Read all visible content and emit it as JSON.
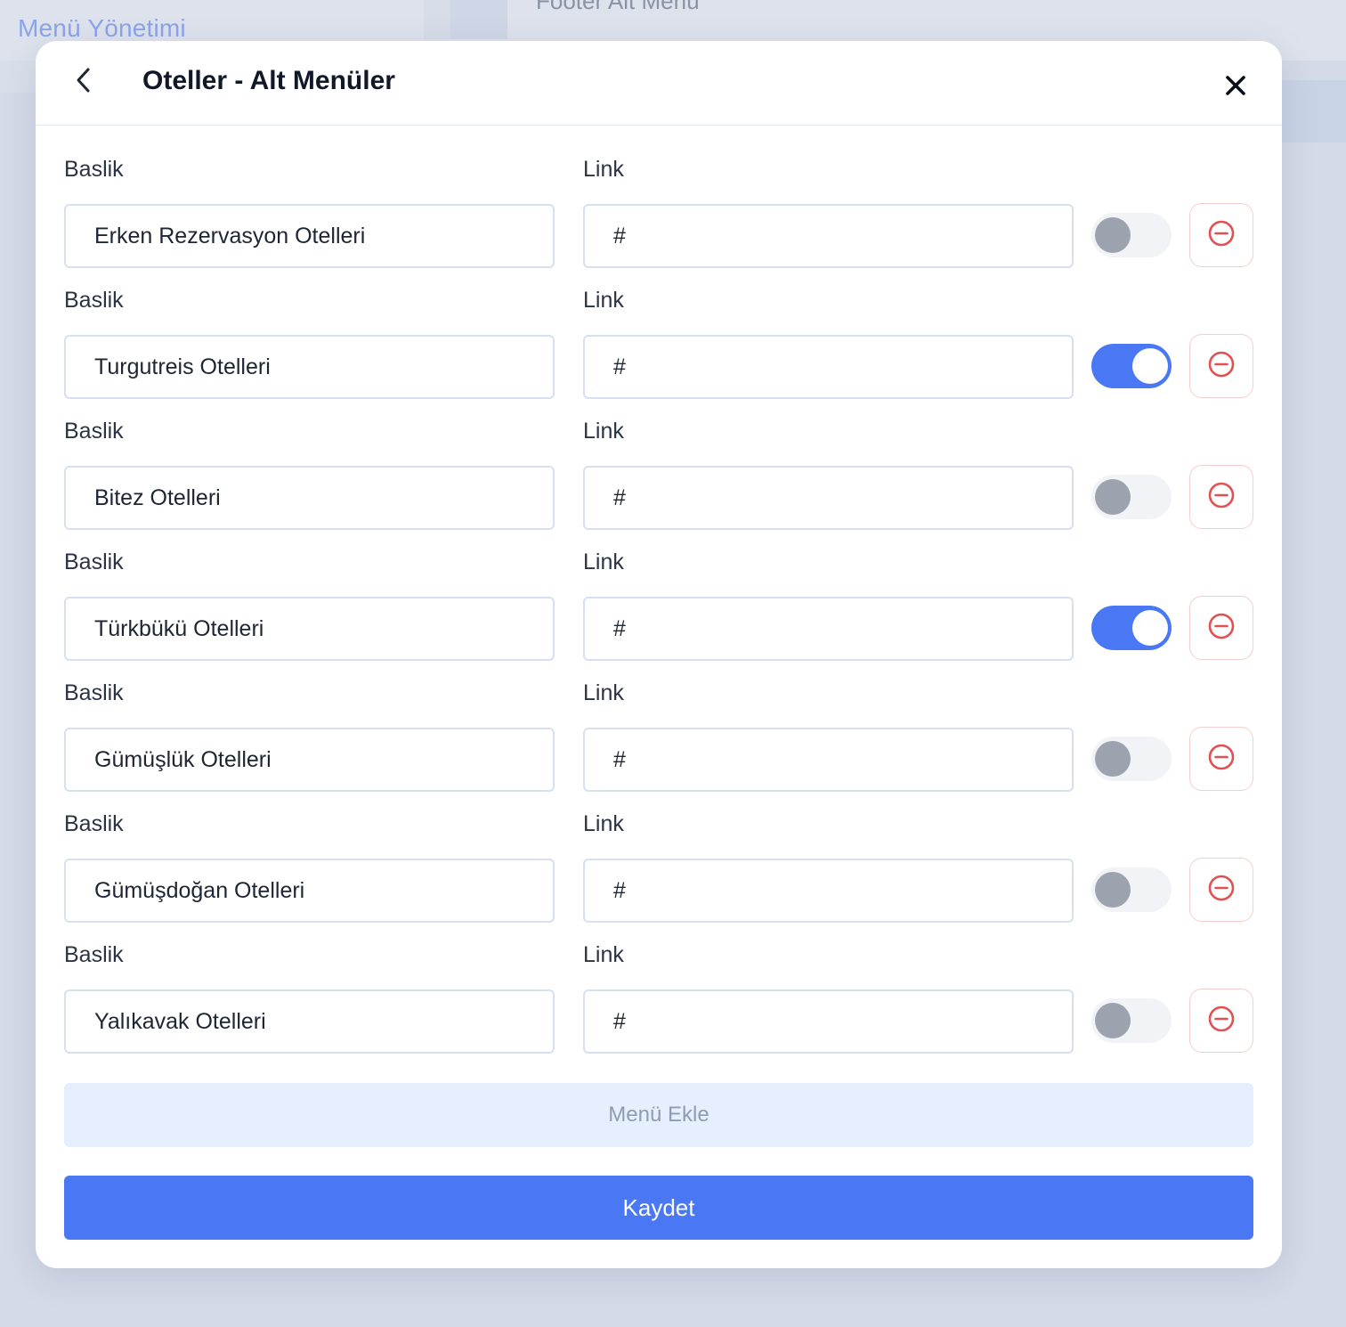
{
  "background": {
    "page_title": "Menü Yönetimi",
    "section_title": "Footer Alt Menü"
  },
  "modal": {
    "title": "Oteller - Alt Menüler",
    "back_icon": "chevron-left-icon",
    "close_icon": "close-icon"
  },
  "labels": {
    "title": "Baslik",
    "link": "Link"
  },
  "items": [
    {
      "title": "Erken Rezervasyon Otelleri",
      "link": "#",
      "active": false
    },
    {
      "title": "Turgutreis Otelleri",
      "link": "#",
      "active": true
    },
    {
      "title": "Bitez Otelleri",
      "link": "#",
      "active": false
    },
    {
      "title": "Türkbükü Otelleri",
      "link": "#",
      "active": true
    },
    {
      "title": "Gümüşlük Otelleri",
      "link": "#",
      "active": false
    },
    {
      "title": "Gümüşdoğan Otelleri",
      "link": "#",
      "active": false
    },
    {
      "title": "Yalıkavak Otelleri",
      "link": "#",
      "active": false
    }
  ],
  "actions": {
    "add_label": "Menü Ekle",
    "save_label": "Kaydet"
  },
  "colors": {
    "primary": "#4a78f5",
    "danger": "#e05252",
    "add_button_bg": "#e6effd"
  }
}
